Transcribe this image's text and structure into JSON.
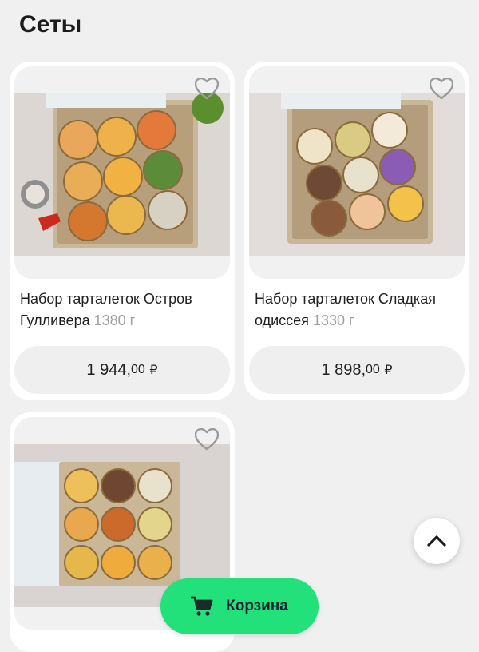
{
  "section": {
    "title": "Сеты"
  },
  "products": [
    {
      "name": "Набор тарталеток Остров Гулливера",
      "weight": "1380 г",
      "price_int": "1 944,",
      "price_dec": "00",
      "currency": "₽"
    },
    {
      "name": "Набор тарталеток Сладкая одиссея",
      "weight": "1330 г",
      "price_int": "1 898,",
      "price_dec": "00",
      "currency": "₽"
    },
    {
      "name": "",
      "weight": "",
      "price_int": "",
      "price_dec": "",
      "currency": ""
    }
  ],
  "cart": {
    "label": "Корзина",
    "icon": "cart-icon"
  },
  "scroll_top": {
    "icon": "chevron-up-icon"
  },
  "colors": {
    "accent": "#22e07a",
    "card": "#ffffff",
    "background": "#f0f0f0",
    "muted": "#a0a0a0"
  }
}
